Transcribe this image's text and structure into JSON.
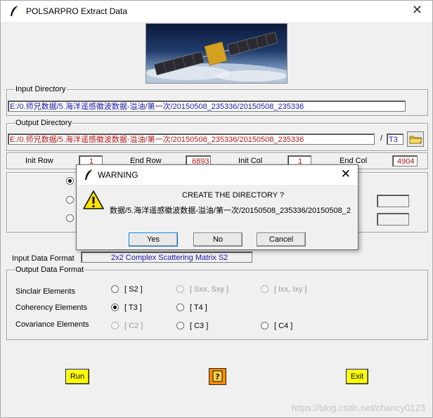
{
  "window": {
    "title": "POLSARPRO Extract Data"
  },
  "input_directory": {
    "label": "Input Directory",
    "path": "E:/0.师兄数据/5.海洋遥感徽波数据-溢油/第一次/20150508_235336/20150508_235336"
  },
  "output_directory": {
    "label": "Output Directory",
    "path": "E:/0.师兄数据/5.海洋遥感徽波数据-溢油/第一次/20150508_235336/20150508_235336",
    "separator": "/",
    "subdir": "T3",
    "browse_icon": "folder-icon"
  },
  "ranges": {
    "init_row_label": "Init Row",
    "init_row": "1",
    "end_row_label": "End Row",
    "end_row": "6893",
    "init_col_label": "Init Col",
    "init_col": "1",
    "end_col_label": "End Col",
    "end_col": "4904"
  },
  "input_format": {
    "label": "Input Data Format",
    "value": "2x2 Complex Scattering Matrix S2"
  },
  "output_format": {
    "label": "Output Data Format",
    "rows": [
      {
        "label": "Sinclair Elements",
        "options": [
          {
            "text": "[ S2 ]",
            "selected": false,
            "disabled": false
          },
          {
            "text": "[ Sxx, Sxy ]",
            "selected": false,
            "disabled": true
          },
          {
            "text": "[ Ixx, Ixy ]",
            "selected": false,
            "disabled": true
          }
        ]
      },
      {
        "label": "Coherency Elements",
        "options": [
          {
            "text": "[ T3 ]",
            "selected": true,
            "disabled": false
          },
          {
            "text": "[ T4 ]",
            "selected": false,
            "disabled": false
          }
        ]
      },
      {
        "label": "Covariance Elements",
        "options": [
          {
            "text": "[ C2 ]",
            "selected": false,
            "disabled": true
          },
          {
            "text": "[ C3 ]",
            "selected": false,
            "disabled": false
          },
          {
            "text": "[ C4 ]",
            "selected": false,
            "disabled": false
          }
        ]
      }
    ]
  },
  "buttons": {
    "run": "Run",
    "help": "?",
    "exit": "Exit"
  },
  "dialog": {
    "title": "WARNING",
    "heading": "CREATE THE DIRECTORY ?",
    "path": "数据/5.海洋遥感徽波数据-溢油/第一次/20150508_235336/20150508_2",
    "yes": "Yes",
    "no": "No",
    "cancel": "Cancel",
    "icon": "warning-icon"
  },
  "watermark": "https://blog.csdn.net/chancy0123"
}
